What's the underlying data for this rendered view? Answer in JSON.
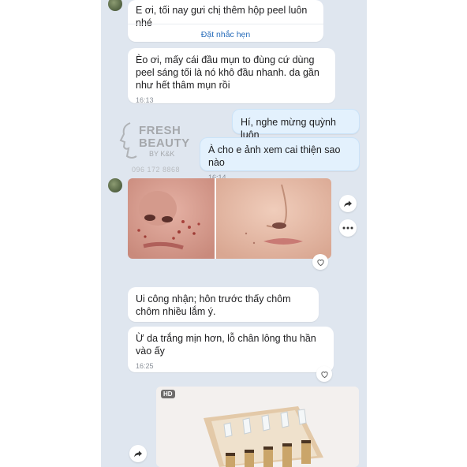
{
  "messages": {
    "m1": {
      "text": "E ơi, tối nay gưi chị thêm hộp peel luôn nhé",
      "reminder": "Đặt nhắc hẹn"
    },
    "m2": {
      "text": "Èo ơi, mấy cái đầu mụn to đùng cứ dùng peel sáng tối là nó khô đầu nhanh. da gần như hết thâm mụn rồi",
      "time": "16:13"
    },
    "m3": {
      "text": "Hí, nghe mừng quỳnh luôn"
    },
    "m4": {
      "text": "À cho e ảnh xem cai thiện sao nào",
      "time": "16:14"
    },
    "m5": {
      "text": "Ui công nhận; hôn trước thấy chôm chôm nhiều lắm ý."
    },
    "m6": {
      "text": "Ừ da trắng mịn hơn, lỗ chân lông thu hần vào ấy",
      "time": "16:25"
    }
  },
  "watermark": {
    "line1": "FRESH",
    "line2": "BEAUTY",
    "line3": "BY K&K",
    "phone": "096 172 8868"
  },
  "video": {
    "badge": "HD"
  },
  "icons": {
    "share": "share-icon",
    "more": "more-icon",
    "heart": "heart-icon"
  }
}
